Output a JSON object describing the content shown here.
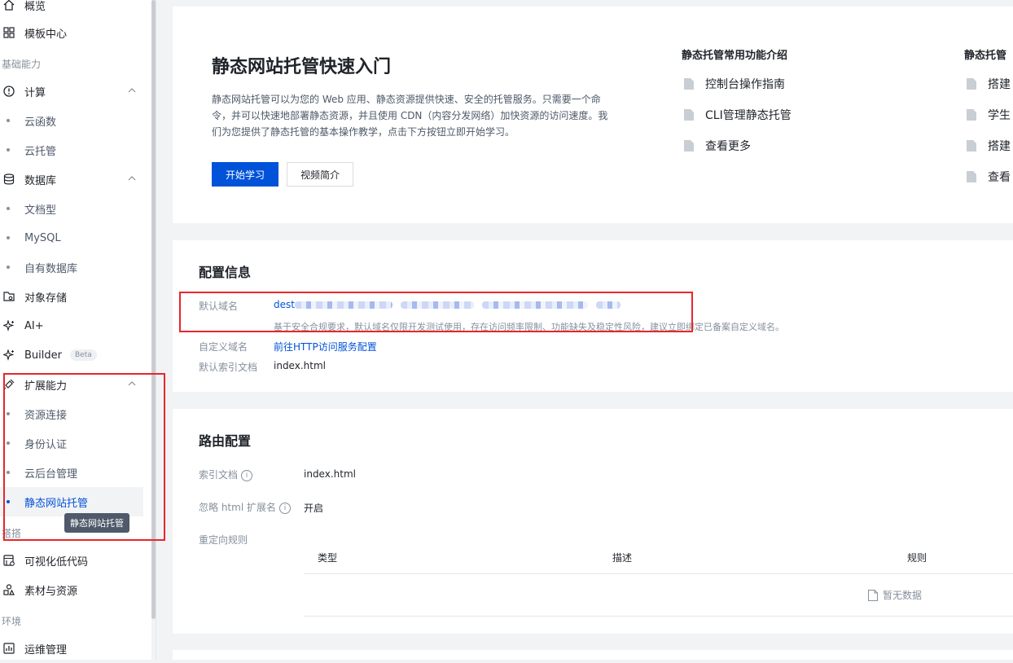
{
  "sidebar": {
    "items": [
      {
        "label": "概览",
        "icon": "home-icon"
      },
      {
        "label": "模板中心",
        "icon": "grid-icon"
      }
    ],
    "group_basic": "基础能力",
    "compute": {
      "label": "计算",
      "icon": "compute-icon",
      "children": [
        "云函数",
        "云托管"
      ]
    },
    "database": {
      "label": "数据库",
      "icon": "database-icon",
      "children": [
        "文档型",
        "MySQL",
        "自有数据库"
      ]
    },
    "storage": {
      "label": "对象存储",
      "icon": "storage-icon"
    },
    "ai": {
      "label": "AI+",
      "icon": "sparkle-icon"
    },
    "builder": {
      "label": "Builder",
      "badge": "Beta",
      "icon": "sparkle-icon"
    },
    "extension": {
      "label": "扩展能力",
      "icon": "plug-icon",
      "children": [
        "资源连接",
        "身份认证",
        "云后台管理",
        "静态网站托管"
      ]
    },
    "group_build": "搭搭",
    "lowcode": {
      "label": "可视化低代码",
      "icon": "lowcode-icon"
    },
    "assets": {
      "label": "素材与资源",
      "icon": "shapes-icon"
    },
    "group_env": "环境",
    "ops": {
      "label": "运维管理",
      "icon": "ops-icon"
    },
    "tooltip": "静态网站托管"
  },
  "quickstart": {
    "title": "静态网站托管快速入门",
    "intro": "静态网站托管可以为您的 Web 应用、静态资源提供快速、安全的托管服务。只需要一个命令，并可以快速地部署静态资源，并且使用 CDN（内容分发网络）加快资源的访问速度。我们为您提供了静态托管的基本操作教学，点击下方按钮立即开始学习。",
    "start_btn": "开始学习",
    "video_btn": "视频简介",
    "col1": {
      "title": "静态托管常用功能介绍",
      "links": [
        "控制台操作指南",
        "CLI管理静态托管",
        "查看更多"
      ]
    },
    "col2": {
      "title": "静态托管",
      "links": [
        "搭建",
        "学生",
        "搭建",
        "查看"
      ]
    }
  },
  "config": {
    "title": "配置信息",
    "default_domain_label": "默认域名",
    "default_domain_prefix": "dest",
    "domain_note": "基于安全合规要求，默认域名仅限开发测试使用，存在访问频率限制、功能缺失及稳定性风险，建议立即绑定已备案自定义域名。",
    "custom_domain_label": "自定义域名",
    "custom_domain_link": "前往HTTP访问服务配置",
    "index_label": "默认索引文档",
    "index_value": "index.html"
  },
  "routing": {
    "title": "路由配置",
    "index_label": "索引文档",
    "index_value": "index.html",
    "ignore_label": "忽略 html 扩展名",
    "ignore_value": "开启",
    "redirect_label": "重定向规则",
    "columns": [
      "类型",
      "描述",
      "规则"
    ],
    "empty": "暂无数据"
  }
}
